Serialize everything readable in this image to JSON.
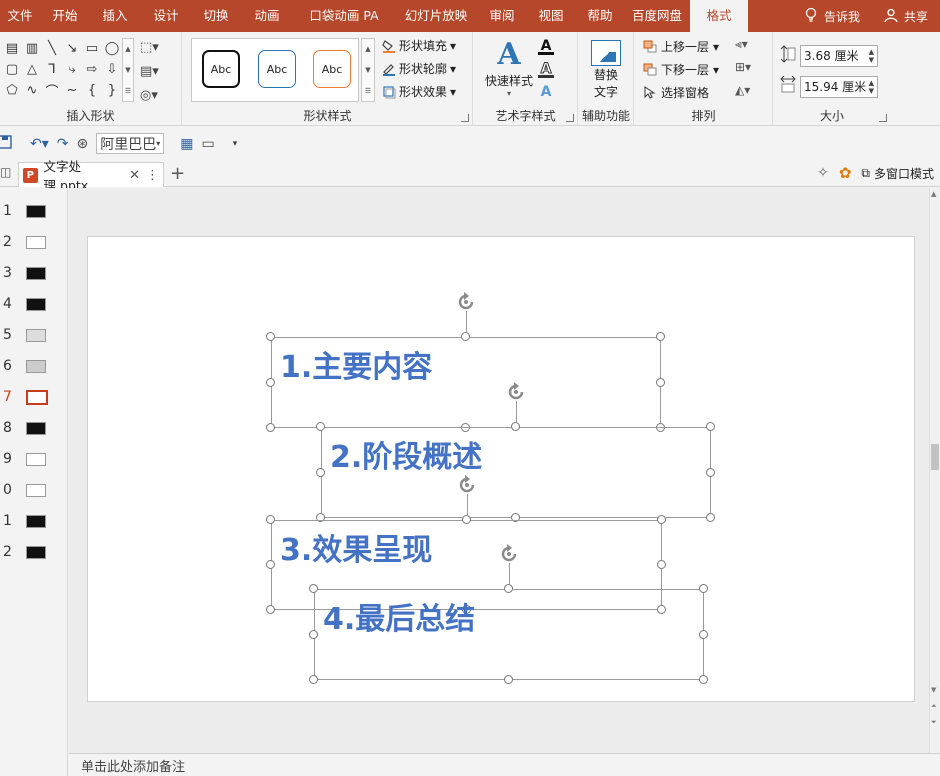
{
  "menu": {
    "tabs": [
      "文件",
      "开始",
      "插入",
      "设计",
      "切换",
      "动画",
      "口袋动画 PA",
      "幻灯片放映",
      "审阅",
      "视图",
      "帮助",
      "百度网盘",
      "格式"
    ],
    "active": "格式",
    "tell_me": "告诉我",
    "share": "共享"
  },
  "ribbon": {
    "groups": {
      "insert_shapes": "插入形状",
      "shape_styles": "形状样式",
      "art_text": "艺术字样式",
      "accessibility": "辅助功能",
      "arrange": "排列",
      "size": "大小"
    },
    "shape_style_samples": [
      "Abc",
      "Abc",
      "Abc"
    ],
    "shape_fill": "形状填充",
    "shape_outline": "形状轮廓",
    "shape_effects": "形状效果",
    "quick_styles": "快速样式",
    "alt_text_line1": "替换",
    "alt_text_line2": "文字",
    "bring_forward": "上移一层",
    "send_backward": "下移一层",
    "selection_pane": "选择窗格",
    "height": "3.68 厘米",
    "width": "15.94 厘米"
  },
  "qat": {
    "font": "阿里巴巴"
  },
  "tabbar": {
    "document": "文字处理.pptx",
    "multi_window": "多窗口模式"
  },
  "thumbnails": [
    "1",
    "2",
    "3",
    "4",
    "5",
    "6",
    "7",
    "8",
    "9",
    "0",
    "1",
    "2"
  ],
  "active_slide_index": 6,
  "slide": {
    "boxes": [
      "1.主要内容",
      "2.阶段概述",
      "3.效果呈现",
      "4.最后总结"
    ]
  },
  "notes_placeholder": "单击此处添加备注",
  "colors": {
    "brand": "#b7472a",
    "text_blue": "#4472c4"
  }
}
